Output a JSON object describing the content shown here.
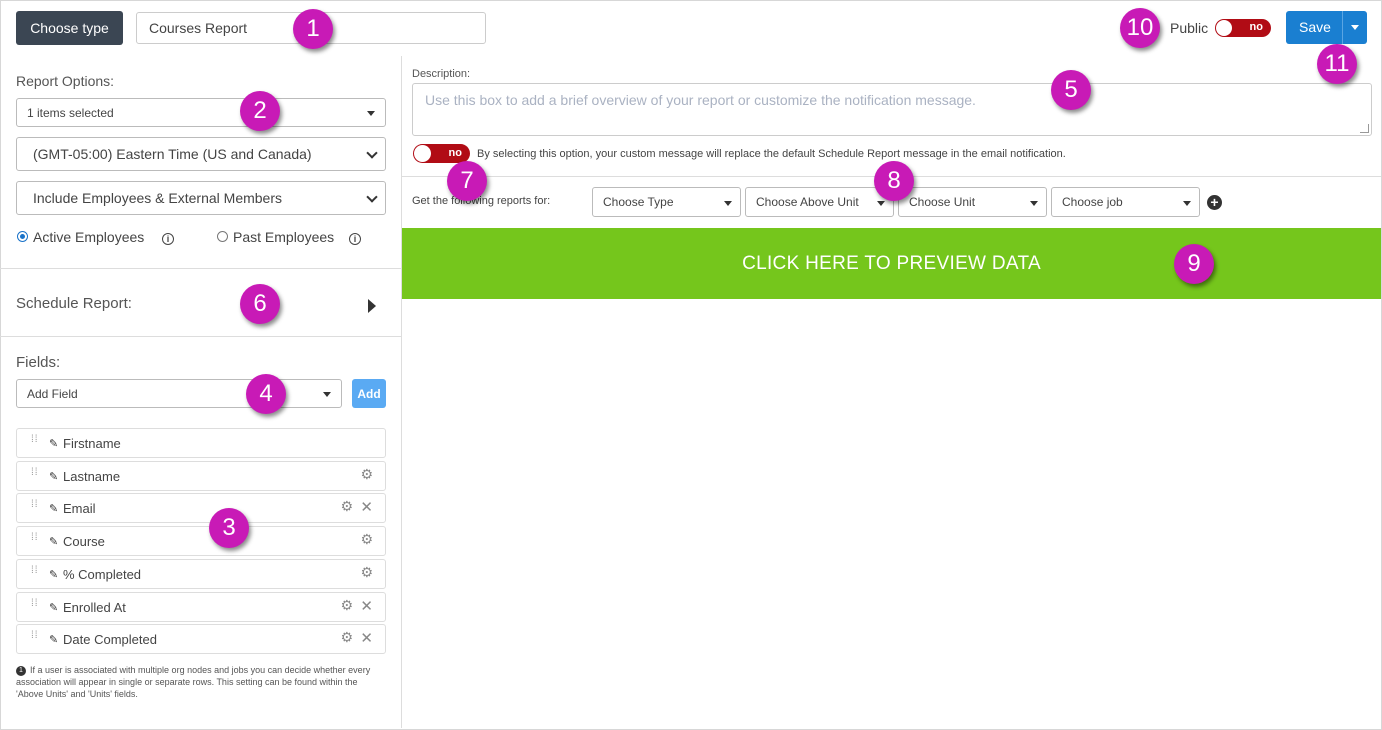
{
  "header": {
    "choose_type_label": "Choose type",
    "report_title": "Courses Report",
    "public_label": "Public",
    "public_toggle": "no",
    "save_label": "Save"
  },
  "report_options": {
    "heading": "Report Options:",
    "items_selected": "1 items selected",
    "timezone": "(GMT-05:00) Eastern Time (US and Canada)",
    "members": "Include Employees & External Members",
    "radio_active": "Active Employees",
    "radio_past": "Past Employees",
    "selected_radio": "active"
  },
  "schedule": {
    "label": "Schedule Report:"
  },
  "fields": {
    "heading": "Fields:",
    "add_field_placeholder": "Add Field",
    "add_button": "Add",
    "items": [
      {
        "name": "Firstname",
        "gear": false,
        "remove": false
      },
      {
        "name": "Lastname",
        "gear": true,
        "remove": false
      },
      {
        "name": "Email",
        "gear": true,
        "remove": true
      },
      {
        "name": "Course",
        "gear": true,
        "remove": false
      },
      {
        "name": "% Completed",
        "gear": true,
        "remove": false
      },
      {
        "name": "Enrolled At",
        "gear": true,
        "remove": true
      },
      {
        "name": "Date Completed",
        "gear": true,
        "remove": true
      }
    ],
    "note_bullet": "1",
    "note": "If a user is associated with multiple org nodes and jobs you can decide whether every association will appear in single or separate rows. This setting can be found within the 'Above Units' and 'Units' fields."
  },
  "description": {
    "label": "Description:",
    "placeholder": "Use this box to add a brief overview of your report or customize the notification message.",
    "toggle": "no",
    "custom_message_note": "By selecting this option, your custom message will replace the default Schedule Report message in the email notification."
  },
  "filters": {
    "label": "Get the following reports for:",
    "choose_type": "Choose Type",
    "choose_above_unit": "Choose Above Unit",
    "choose_unit": "Choose Unit",
    "choose_job": "Choose job"
  },
  "preview": {
    "label": "CLICK HERE TO PREVIEW DATA"
  },
  "markers": [
    "1",
    "2",
    "3",
    "4",
    "5",
    "6",
    "7",
    "8",
    "9",
    "10",
    "11"
  ],
  "colors": {
    "dark_button": "#3b4653",
    "save_blue": "#1a7fd1",
    "toggle_red": "#b10c15",
    "preview_green": "#75c61c",
    "marker_magenta": "#c81ab6"
  }
}
